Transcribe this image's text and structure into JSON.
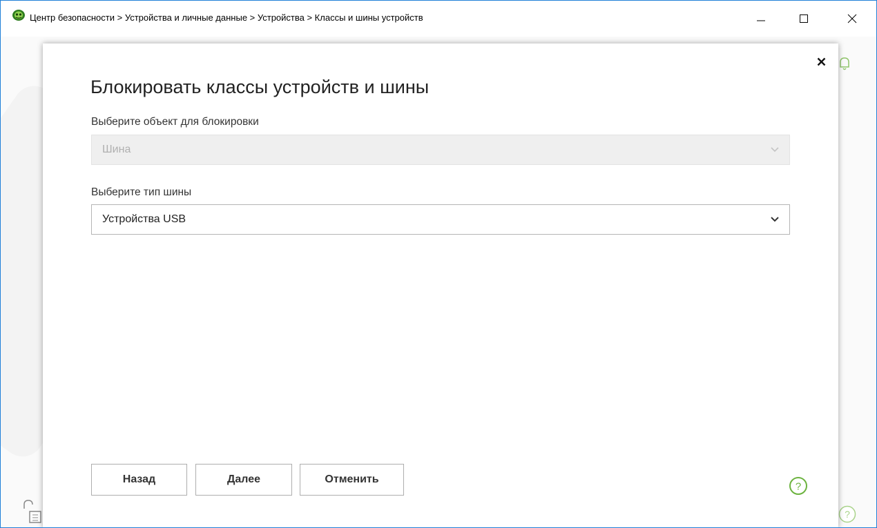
{
  "window": {
    "title": "Центр безопасности > Устройства и личные данные > Устройства > Классы и шины устройств",
    "accent_color": "#1e7fd8",
    "app_icon": "spider-logo-icon"
  },
  "dialog": {
    "title": "Блокировать классы устройств и шины",
    "object_label": "Выберите объект для блокировки",
    "object_value": "Шина",
    "bus_label": "Выберите тип шины",
    "bus_value": "Устройства USB",
    "buttons": {
      "back": "Назад",
      "next": "Далее",
      "cancel": "Отменить"
    },
    "help_icon_color": "#6cb33f"
  }
}
